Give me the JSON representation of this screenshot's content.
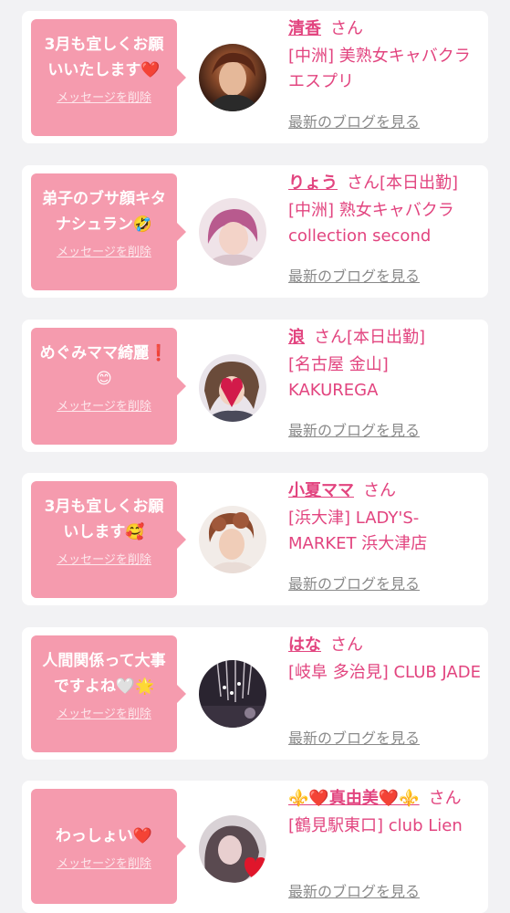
{
  "cards": [
    {
      "message": "3月も宜しくお願いいたします❤️",
      "delete_label": "メッセージを削除",
      "name": "清香",
      "san_suffix": "さん",
      "status": "",
      "store": "[中洲] 美熟女キャバクラ エスプリ",
      "blog_label": "最新のブログを見る"
    },
    {
      "message": "弟子のブサ顔キタナシュラン🤣",
      "delete_label": "メッセージを削除",
      "name": "りょう",
      "san_suffix": "さん",
      "status": "[本日出勤]",
      "store": "[中洲] 熟女キャバクラ collection second",
      "blog_label": "最新のブログを見る"
    },
    {
      "message": "めぐみママ綺麗❗️😊",
      "delete_label": "メッセージを削除",
      "name": "浪",
      "san_suffix": "さん",
      "status": "[本日出勤]",
      "store": "[名古屋 金山] KAKUREGA",
      "blog_label": "最新のブログを見る"
    },
    {
      "message": "3月も宜しくお願いします🥰",
      "delete_label": "メッセージを削除",
      "name": "小夏ママ",
      "san_suffix": "さん",
      "status": "",
      "store": "[浜大津] LADY'S-MARKET 浜大津店",
      "blog_label": "最新のブログを見る"
    },
    {
      "message": "人間関係って大事ですよね🤍🌟",
      "delete_label": "メッセージを削除",
      "name": "はな",
      "san_suffix": "さん",
      "status": "",
      "store": "[岐阜 多治見] CLUB JADE",
      "blog_label": "最新のブログを見る"
    },
    {
      "message": "わっしょい❤️",
      "delete_label": "メッセージを削除",
      "name": "⚜️❤️真由美❤️⚜️",
      "san_suffix": "さん",
      "status": "",
      "store": "[鶴見駅東口] club Lien",
      "blog_label": "最新のブログを見る"
    }
  ]
}
